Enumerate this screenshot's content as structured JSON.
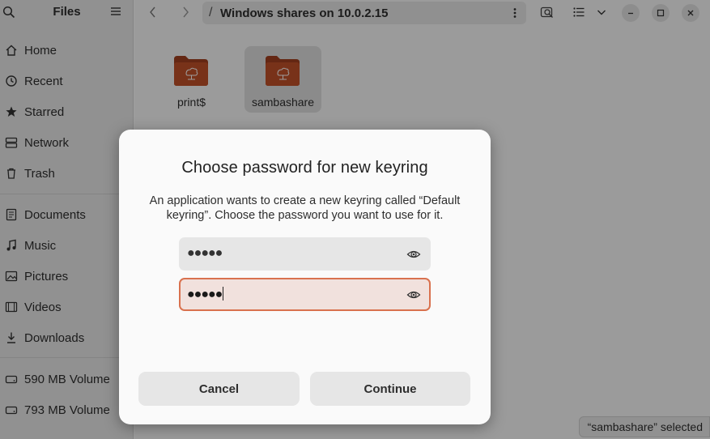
{
  "sidebar": {
    "title": "Files",
    "places": [
      {
        "label": "Home",
        "icon": "home-icon"
      },
      {
        "label": "Recent",
        "icon": "clock-icon"
      },
      {
        "label": "Starred",
        "icon": "star-icon"
      },
      {
        "label": "Network",
        "icon": "network-icon"
      },
      {
        "label": "Trash",
        "icon": "trash-icon"
      }
    ],
    "bookmarks": [
      {
        "label": "Documents",
        "icon": "documents-icon"
      },
      {
        "label": "Music",
        "icon": "music-icon"
      },
      {
        "label": "Pictures",
        "icon": "pictures-icon"
      },
      {
        "label": "Videos",
        "icon": "videos-icon"
      },
      {
        "label": "Downloads",
        "icon": "downloads-icon"
      }
    ],
    "volumes": [
      {
        "label": "590 MB Volume",
        "icon": "drive-icon"
      },
      {
        "label": "793 MB Volume",
        "icon": "drive-icon"
      }
    ]
  },
  "header": {
    "path": "Windows shares on 10.0.2.15",
    "separator": "/"
  },
  "files": [
    {
      "name": "print$",
      "icon": "network-folder-icon",
      "selected": false
    },
    {
      "name": "sambashare",
      "icon": "network-folder-icon",
      "selected": true
    }
  ],
  "status": "“sambashare” selected",
  "dialog": {
    "title": "Choose password for new keyring",
    "message": "An application wants to create a new keyring called “Default keyring”. Choose the password you want to use for it.",
    "password_dots": "●●●●●",
    "confirm_dots": "●●●●●",
    "cancel_label": "Cancel",
    "continue_label": "Continue"
  },
  "colors": {
    "accent": "#d9714e",
    "folder": "#a2401f",
    "sidebar_bg": "#ebebeb"
  }
}
